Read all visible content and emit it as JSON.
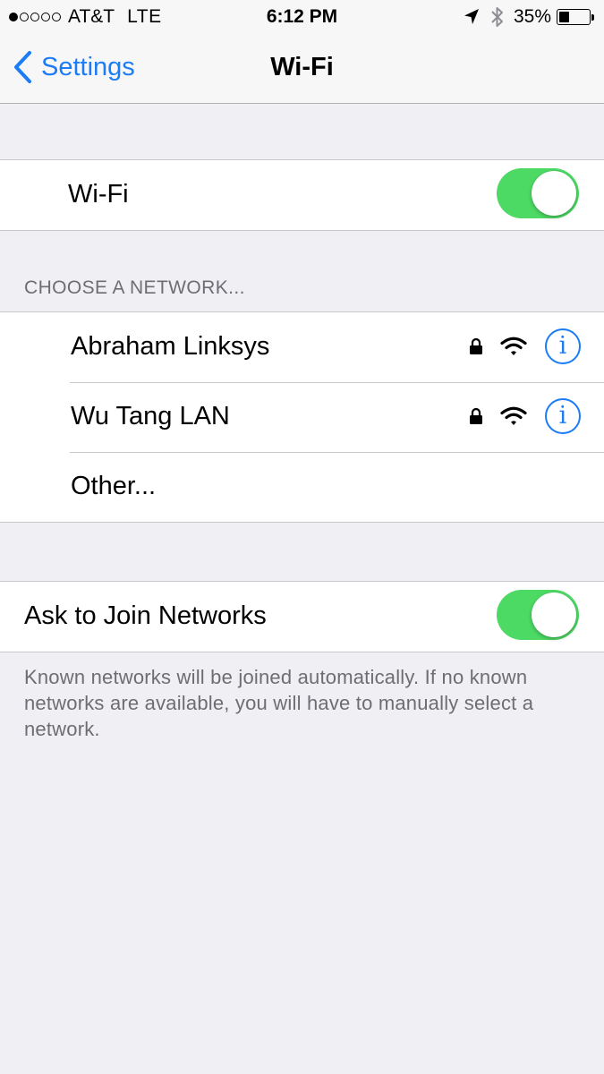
{
  "status_bar": {
    "signal_bars_filled": 1,
    "signal_bars_total": 5,
    "carrier": "AT&T",
    "network_type": "LTE",
    "time": "6:12 PM",
    "battery_percent": "35%",
    "battery_level": 0.35,
    "icons": [
      "location-arrow-icon",
      "bluetooth-icon",
      "battery-icon"
    ]
  },
  "nav": {
    "back_label": "Settings",
    "title": "Wi-Fi"
  },
  "wifi_toggle": {
    "label": "Wi-Fi",
    "on": true
  },
  "networks": {
    "header": "CHOOSE A NETWORK...",
    "items": [
      {
        "name": "Abraham Linksys",
        "secured": true
      },
      {
        "name": "Wu Tang LAN",
        "secured": true
      }
    ],
    "other_label": "Other..."
  },
  "ask_to_join": {
    "label": "Ask to Join Networks",
    "on": true,
    "note": "Known networks will be joined automatically. If no known networks are available, you will have to manually select a network."
  },
  "colors": {
    "accent": "#1b7cf5",
    "toggle_on": "#4cd964",
    "background": "#efeff4",
    "secondary_text": "#6d6d72"
  }
}
